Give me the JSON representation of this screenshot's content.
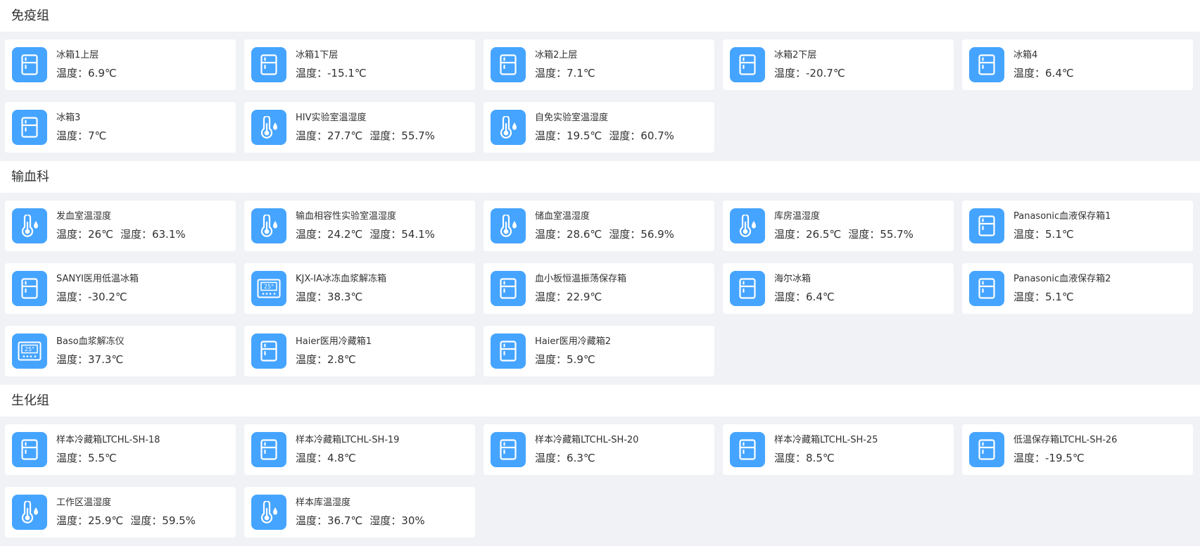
{
  "labels": {
    "temperature": "温度：",
    "humidity": "湿度："
  },
  "colors": {
    "icon_bg": "#45a4ff",
    "page_bg": "#f0f2f5"
  },
  "groups": [
    {
      "title": "免疫组",
      "devices": [
        {
          "name": "冰箱1上层",
          "icon": "fridge-icon",
          "temp": "6.9℃"
        },
        {
          "name": "冰箱1下层",
          "icon": "fridge-icon",
          "temp": "-15.1℃"
        },
        {
          "name": "冰箱2上层",
          "icon": "fridge-icon",
          "temp": "7.1℃"
        },
        {
          "name": "冰箱2下层",
          "icon": "fridge-icon",
          "temp": "-20.7℃"
        },
        {
          "name": "冰箱4",
          "icon": "fridge-icon",
          "temp": "6.4℃"
        },
        {
          "name": "冰箱3",
          "icon": "fridge-icon",
          "temp": "7℃"
        },
        {
          "name": "HIV实验室温湿度",
          "icon": "thermo-hygrometer-icon",
          "temp": "27.7℃",
          "humidity": "55.7%"
        },
        {
          "name": "自免实验室温湿度",
          "icon": "thermo-hygrometer-icon",
          "temp": "19.5℃",
          "humidity": "60.7%"
        }
      ]
    },
    {
      "title": "输血科",
      "devices": [
        {
          "name": "发血室温湿度",
          "icon": "thermo-hygrometer-icon",
          "temp": "26℃",
          "humidity": "63.1%"
        },
        {
          "name": "输血相容性实验室温湿度",
          "icon": "thermo-hygrometer-icon",
          "temp": "24.2℃",
          "humidity": "54.1%"
        },
        {
          "name": "储血室温湿度",
          "icon": "thermo-hygrometer-icon",
          "temp": "28.6℃",
          "humidity": "56.9%"
        },
        {
          "name": "库房温湿度",
          "icon": "thermo-hygrometer-icon",
          "temp": "26.5℃",
          "humidity": "55.7%"
        },
        {
          "name": "Panasonic血液保存箱1",
          "icon": "fridge-icon",
          "temp": "5.1℃"
        },
        {
          "name": "SANYI医用低温冰箱",
          "icon": "fridge-icon",
          "temp": "-30.2℃"
        },
        {
          "name": "KJX-IA冰冻血浆解冻箱",
          "icon": "thawing-device-icon",
          "temp": "38.3℃"
        },
        {
          "name": "血小板恒温振荡保存箱",
          "icon": "fridge-icon",
          "temp": "22.9℃"
        },
        {
          "name": "海尔冰箱",
          "icon": "fridge-icon",
          "temp": "6.4℃"
        },
        {
          "name": "Panasonic血液保存箱2",
          "icon": "fridge-icon",
          "temp": "5.1℃"
        },
        {
          "name": "Baso血浆解冻仪",
          "icon": "thawing-device-icon",
          "temp": "37.3℃"
        },
        {
          "name": "Haier医用冷藏箱1",
          "icon": "fridge-icon",
          "temp": "2.8℃"
        },
        {
          "name": "Haier医用冷藏箱2",
          "icon": "fridge-icon",
          "temp": "5.9℃"
        }
      ]
    },
    {
      "title": "生化组",
      "devices": [
        {
          "name": "样本冷藏箱LTCHL-SH-18",
          "icon": "fridge-icon",
          "temp": "5.5℃"
        },
        {
          "name": "样本冷藏箱LTCHL-SH-19",
          "icon": "fridge-icon",
          "temp": "4.8℃"
        },
        {
          "name": "样本冷藏箱LTCHL-SH-20",
          "icon": "fridge-icon",
          "temp": "6.3℃"
        },
        {
          "name": "样本冷藏箱LTCHL-SH-25",
          "icon": "fridge-icon",
          "temp": "8.5℃"
        },
        {
          "name": "低温保存箱LTCHL-SH-26",
          "icon": "fridge-icon",
          "temp": "-19.5℃"
        },
        {
          "name": "工作区温湿度",
          "icon": "thermo-hygrometer-icon",
          "temp": "25.9℃",
          "humidity": "59.5%"
        },
        {
          "name": "样本库温湿度",
          "icon": "thermo-hygrometer-icon",
          "temp": "36.7℃",
          "humidity": "30%"
        }
      ]
    }
  ]
}
